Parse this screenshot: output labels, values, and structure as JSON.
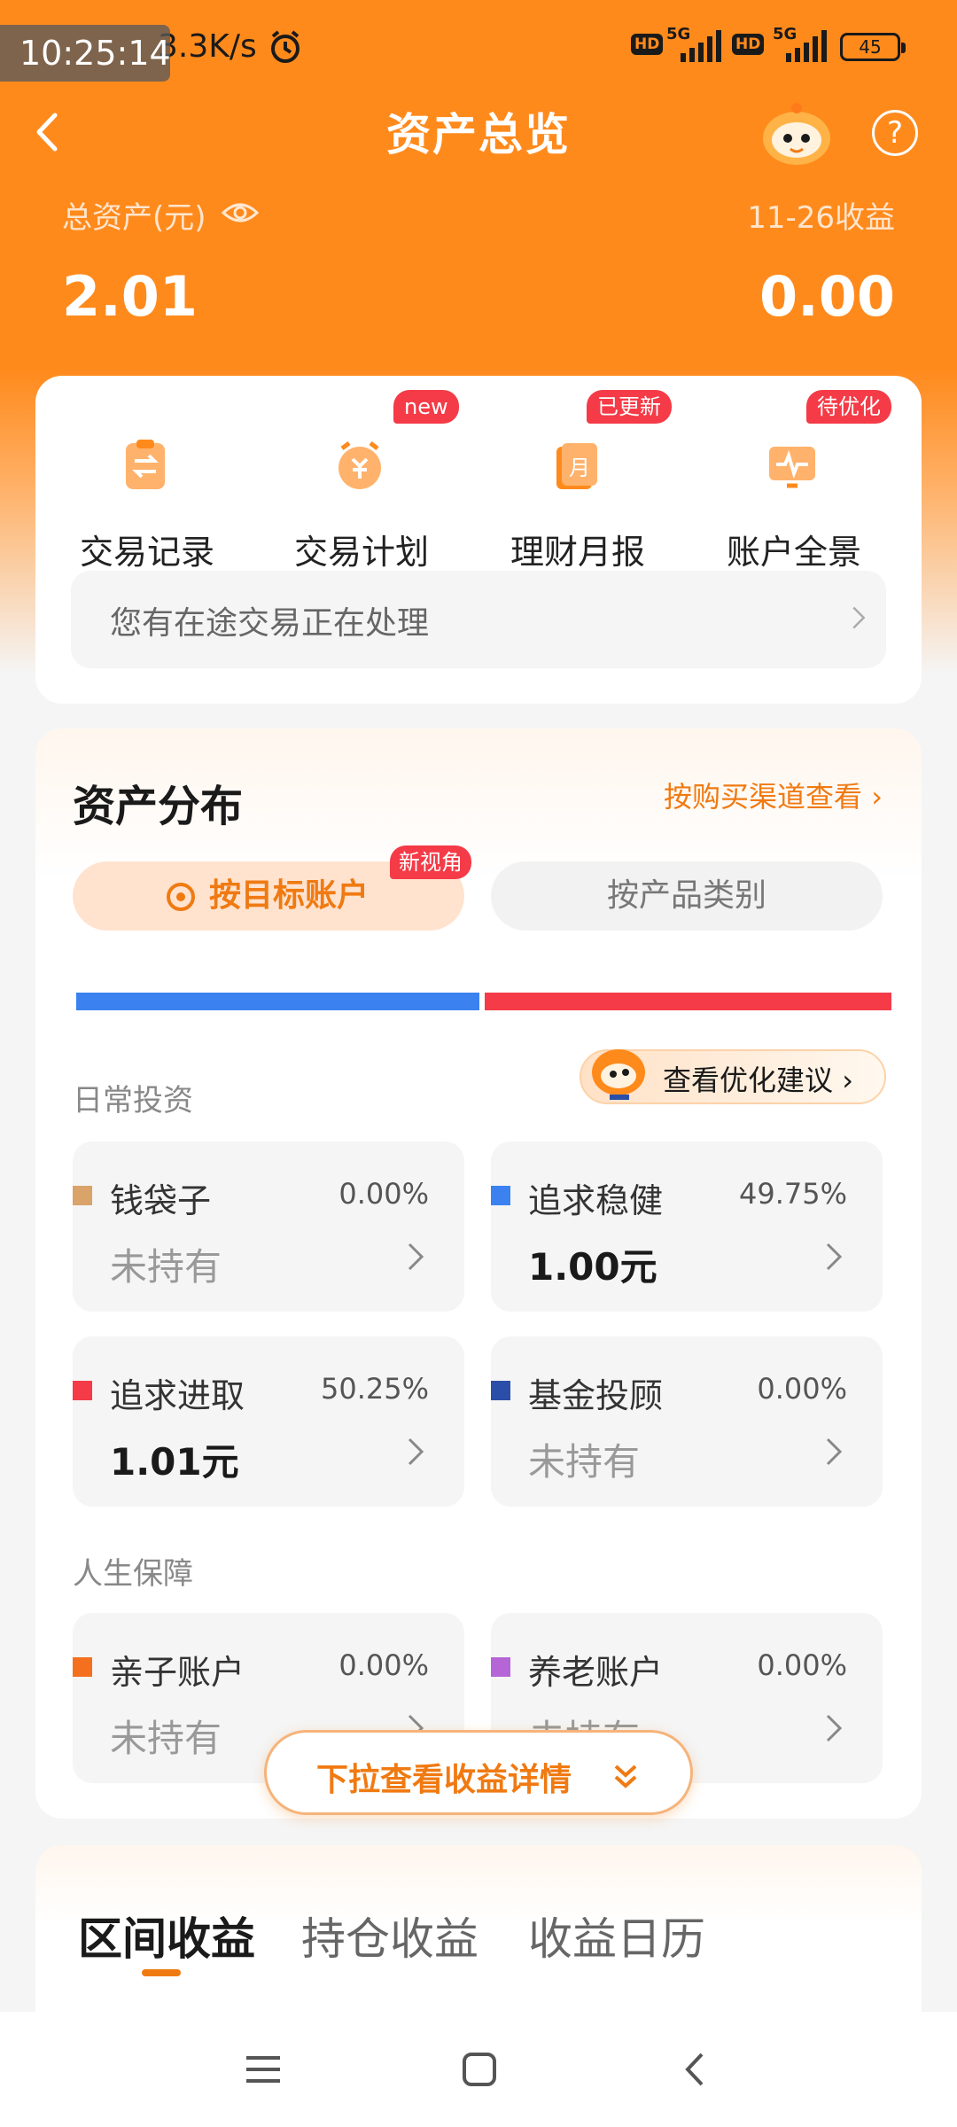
{
  "status_bar": {
    "clock": "10:25:14",
    "net_speed": "3.3K/s",
    "signal_labels": [
      "HD",
      "5G",
      "HD",
      "5G"
    ],
    "battery": "45"
  },
  "header": {
    "title": "资产总览"
  },
  "summary": {
    "total_assets_label": "总资产(元)",
    "total_assets_value": "2.01",
    "income_label": "11-26收益",
    "income_value": "0.00"
  },
  "quick_actions": {
    "items": [
      {
        "label": "交易记录",
        "badge": "",
        "icon": "transfer-icon"
      },
      {
        "label": "交易计划",
        "badge": "new",
        "icon": "plan-clock-icon"
      },
      {
        "label": "理财月报",
        "badge": "已更新",
        "icon": "monthly-report-icon"
      },
      {
        "label": "账户全景",
        "badge": "待优化",
        "icon": "pulse-chart-icon"
      }
    ],
    "transit_text": "您有在途交易正在处理"
  },
  "distribution": {
    "title": "资产分布",
    "channel_link": "按购买渠道查看",
    "segments": [
      "按目标账户",
      "按产品类别"
    ],
    "segment_badge": "新视角",
    "bar": {
      "blue_share": 0.4975,
      "red_share": 0.5025,
      "blue_color": "#3b82f0",
      "red_color": "#f43b47"
    },
    "suggest_label": "查看优化建议",
    "groups": [
      {
        "label": "日常投资",
        "accounts": [
          {
            "name": "钱袋子",
            "pct": "0.00%",
            "value": "未持有",
            "color": "#d9a36a"
          },
          {
            "name": "追求稳健",
            "pct": "49.75%",
            "value": "1.00元",
            "color": "#3b82f0"
          },
          {
            "name": "追求进取",
            "pct": "50.25%",
            "value": "1.01元",
            "color": "#f43b47"
          },
          {
            "name": "基金投顾",
            "pct": "0.00%",
            "value": "未持有",
            "color": "#2b4fa8"
          }
        ]
      },
      {
        "label": "人生保障",
        "accounts": [
          {
            "name": "亲子账户",
            "pct": "0.00%",
            "value": "未持有",
            "color": "#f5701e"
          },
          {
            "name": "养老账户",
            "pct": "0.00%",
            "value": "未持有",
            "color": "#b565d6"
          }
        ]
      }
    ],
    "pull_label": "下拉查看收益详情"
  },
  "earnings": {
    "tabs": [
      "区间收益",
      "持仓收益",
      "收益日历"
    ]
  },
  "colors": {
    "brand_orange": "#ff8a1c",
    "accent_orange": "#f07a12",
    "badge_red": "#f43b47"
  }
}
